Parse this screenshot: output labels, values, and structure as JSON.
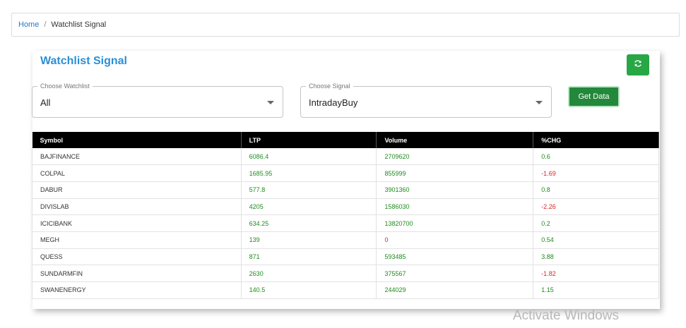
{
  "breadcrumb": {
    "home": "Home",
    "separator": "/",
    "current": "Watchlist Signal"
  },
  "card": {
    "title": "Watchlist Signal",
    "refresh_icon": "refresh-icon",
    "get_data_label": "Get Data"
  },
  "filters": {
    "watchlist": {
      "legend": "Choose Watchlist",
      "value": "All"
    },
    "signal": {
      "legend": "Choose Signal",
      "value": "IntradayBuy"
    }
  },
  "table": {
    "headers": [
      "Symbol",
      "LTP",
      "Volume",
      "%CHG"
    ],
    "rows": [
      {
        "symbol": "BAJFINANCE",
        "ltp": "6086.4",
        "volume": "2709620",
        "chg": "0.6"
      },
      {
        "symbol": "COLPAL",
        "ltp": "1685.95",
        "volume": "855999",
        "chg": "-1.69"
      },
      {
        "symbol": "DABUR",
        "ltp": "577.8",
        "volume": "3901360",
        "chg": "0.8"
      },
      {
        "symbol": "DIVISLAB",
        "ltp": "4205",
        "volume": "1586030",
        "chg": "-2.26"
      },
      {
        "symbol": "ICICIBANK",
        "ltp": "634.25",
        "volume": "13820700",
        "chg": "0.2"
      },
      {
        "symbol": "MEGH",
        "ltp": "139",
        "volume": "0",
        "chg": "0.54"
      },
      {
        "symbol": "QUESS",
        "ltp": "871",
        "volume": "593485",
        "chg": "3.88"
      },
      {
        "symbol": "SUNDARMFIN",
        "ltp": "2630",
        "volume": "375567",
        "chg": "-1.82"
      },
      {
        "symbol": "SWANENERGY",
        "ltp": "140.5",
        "volume": "244029",
        "chg": "1.15"
      }
    ]
  },
  "colors": {
    "accent": "#2b8fd6",
    "button_green": "#28a745",
    "positive": "#1f8a1f",
    "negative": "#e02020"
  },
  "watermark": "Activate Windows"
}
